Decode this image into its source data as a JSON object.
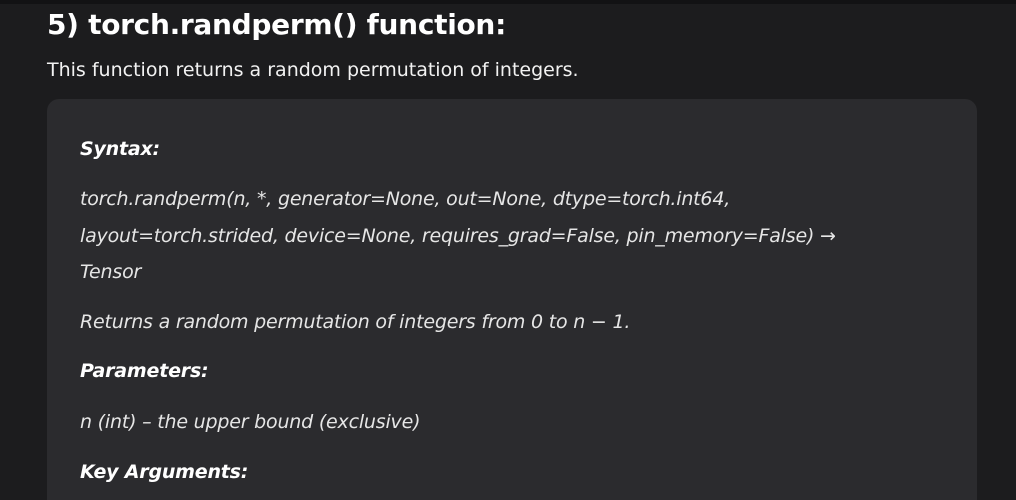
{
  "section": {
    "title": "5) torch.randperm() function:",
    "intro": "This function returns a random permutation of integers."
  },
  "doc": {
    "syntax_label": "Syntax:",
    "signature_lines": [
      "torch.randperm(n, *, generator=None, out=None, dtype=torch.int64,",
      "layout=torch.strided, device=None, requires_grad=False, pin_memory=False) →",
      "Tensor"
    ],
    "description": "Returns a random permutation of integers from 0 to n − 1.",
    "parameters_label": "Parameters:",
    "parameter_n": "n (int) – the upper bound (exclusive)",
    "key_arguments_label": "Key Arguments:"
  }
}
